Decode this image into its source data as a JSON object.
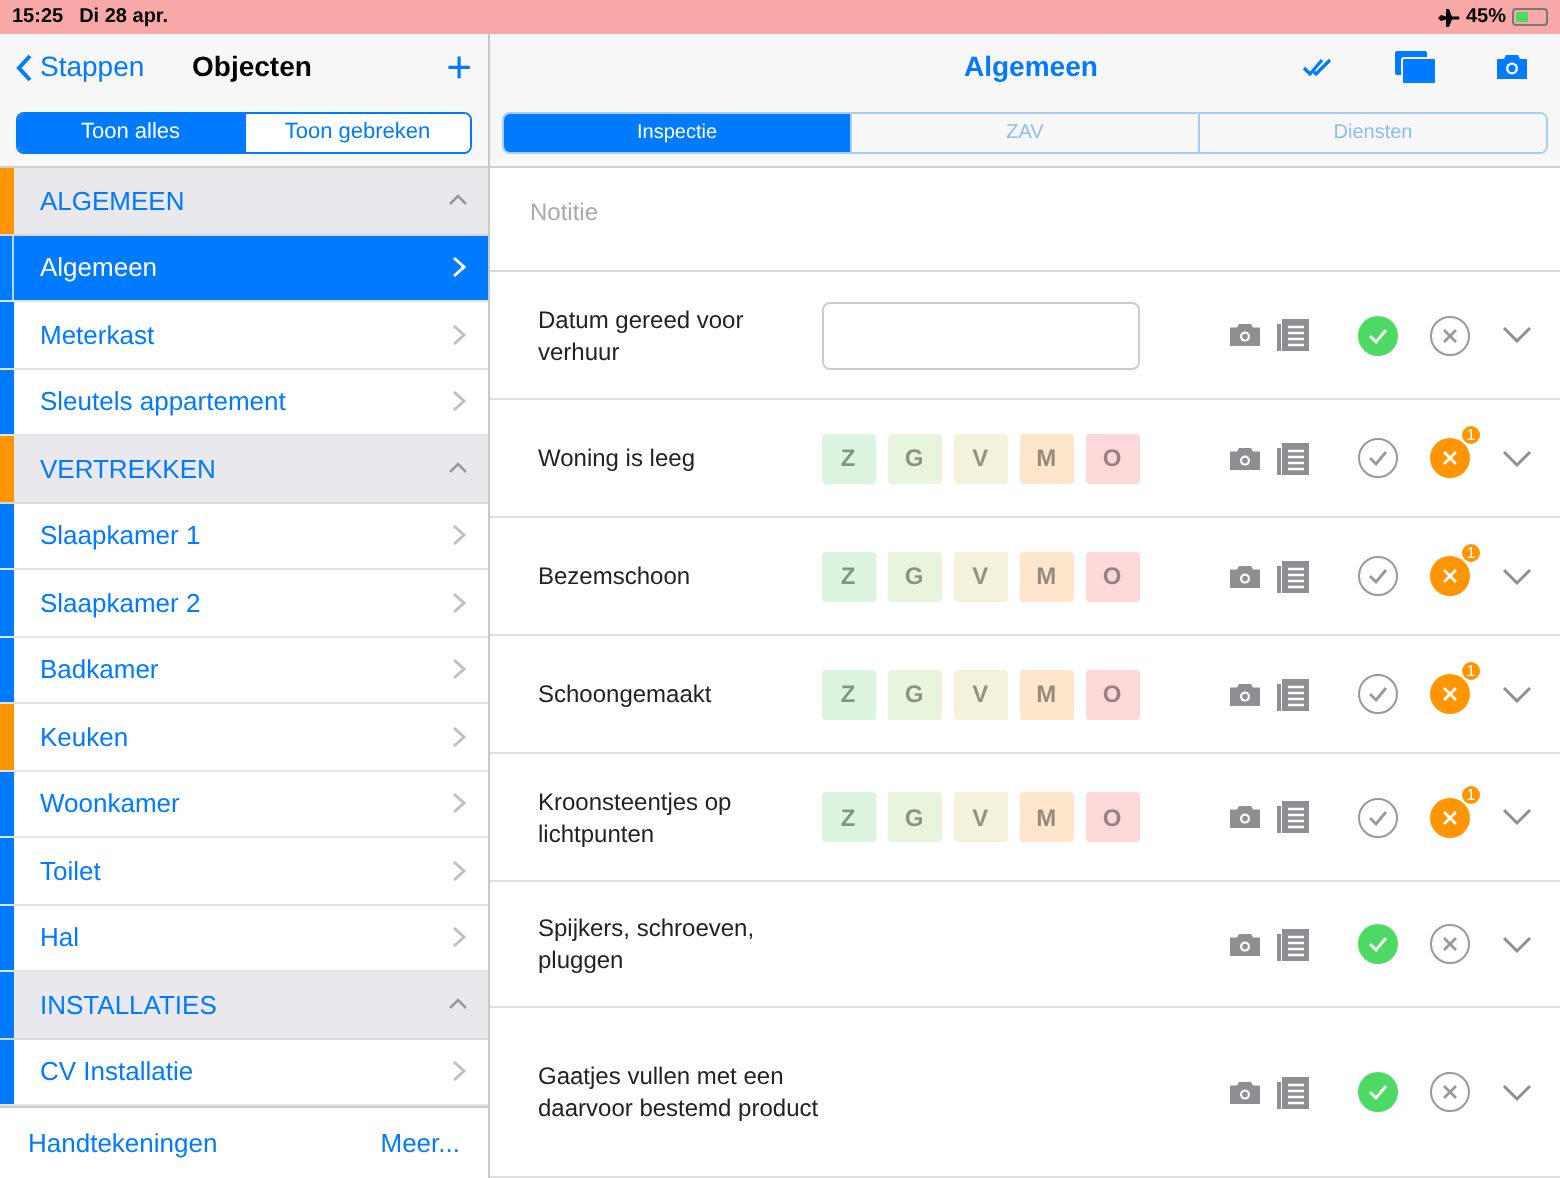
{
  "status_bar": {
    "time": "15:25",
    "date": "Di 28 apr.",
    "battery": "45%"
  },
  "sidebar": {
    "back": "Stappen",
    "title": "Objecten",
    "add": "+",
    "filters": [
      {
        "label": "Toon alles",
        "selected": true
      },
      {
        "label": "Toon gebreken",
        "selected": false
      }
    ],
    "sections": [
      {
        "title": "ALGEMEEN",
        "color": "#ff9500",
        "expanded": true,
        "items": [
          {
            "label": "Algemeen",
            "color": "#007aff",
            "selected": true
          },
          {
            "label": "Meterkast",
            "color": "#007aff",
            "selected": false
          },
          {
            "label": "Sleutels appartement",
            "color": "#007aff",
            "selected": false
          }
        ]
      },
      {
        "title": "VERTREKKEN",
        "color": "#ff9500",
        "expanded": true,
        "items": [
          {
            "label": "Slaapkamer 1",
            "color": "#007aff",
            "selected": false
          },
          {
            "label": "Slaapkamer 2",
            "color": "#007aff",
            "selected": false
          },
          {
            "label": "Badkamer",
            "color": "#007aff",
            "selected": false
          },
          {
            "label": "Keuken",
            "color": "#ff9500",
            "selected": false
          },
          {
            "label": "Woonkamer",
            "color": "#007aff",
            "selected": false
          },
          {
            "label": "Toilet",
            "color": "#007aff",
            "selected": false
          },
          {
            "label": "Hal",
            "color": "#007aff",
            "selected": false
          }
        ]
      },
      {
        "title": "INSTALLATIES",
        "color": "#007aff",
        "expanded": true,
        "items": [
          {
            "label": "CV Installatie",
            "color": "#007aff",
            "selected": false
          }
        ]
      }
    ],
    "footer": [
      "Handtekeningen",
      "Meer..."
    ]
  },
  "main": {
    "title": "Algemeen",
    "tabs": [
      {
        "label": "Inspectie",
        "selected": true
      },
      {
        "label": "ZAV",
        "selected": false
      },
      {
        "label": "Diensten",
        "selected": false
      }
    ],
    "note": {
      "placeholder": "Notitie"
    },
    "rows": [
      {
        "label": "Datum gereed voor verhuur",
        "kind": "input",
        "approved": true,
        "rejected": false
      },
      {
        "label": "Woning is leeg",
        "kind": "rating",
        "approved": false,
        "rejected": true,
        "badge": "1",
        "ratings": [
          {
            "label": "Z",
            "color": "#dcf5e0"
          },
          {
            "label": "G",
            "color": "#e8f4dc"
          },
          {
            "label": "V",
            "color": "#f5f2dc"
          },
          {
            "label": "M",
            "color": "#fde6cc"
          },
          {
            "label": "O",
            "color": "#fdd8d8"
          }
        ]
      },
      {
        "label": "Bezemschoon",
        "kind": "rating",
        "approved": false,
        "rejected": true,
        "badge": "1",
        "ratings": [
          {
            "label": "Z",
            "color": "#dcf5e0"
          },
          {
            "label": "G",
            "color": "#e8f4dc"
          },
          {
            "label": "V",
            "color": "#f5f2dc"
          },
          {
            "label": "M",
            "color": "#fde6cc"
          },
          {
            "label": "O",
            "color": "#fdd8d8"
          }
        ]
      },
      {
        "label": "Schoongemaakt",
        "kind": "rating",
        "approved": false,
        "rejected": true,
        "badge": "1",
        "ratings": [
          {
            "label": "Z",
            "color": "#dcf5e0"
          },
          {
            "label": "G",
            "color": "#e8f4dc"
          },
          {
            "label": "V",
            "color": "#f5f2dc"
          },
          {
            "label": "M",
            "color": "#fde6cc"
          },
          {
            "label": "O",
            "color": "#fdd8d8"
          }
        ]
      },
      {
        "label": "Kroonsteentjes op lichtpunten",
        "kind": "rating",
        "approved": false,
        "rejected": true,
        "badge": "1",
        "ratings": [
          {
            "label": "Z",
            "color": "#dcf5e0"
          },
          {
            "label": "G",
            "color": "#e8f4dc"
          },
          {
            "label": "V",
            "color": "#f5f2dc"
          },
          {
            "label": "M",
            "color": "#fde6cc"
          },
          {
            "label": "O",
            "color": "#fdd8d8"
          }
        ]
      },
      {
        "label": "Spijkers, schroeven, pluggen",
        "kind": "plain",
        "approved": true,
        "rejected": false
      },
      {
        "label": "Gaatjes vullen met een daarvoor bestemd product",
        "kind": "plain",
        "approved": true,
        "rejected": false
      }
    ]
  }
}
